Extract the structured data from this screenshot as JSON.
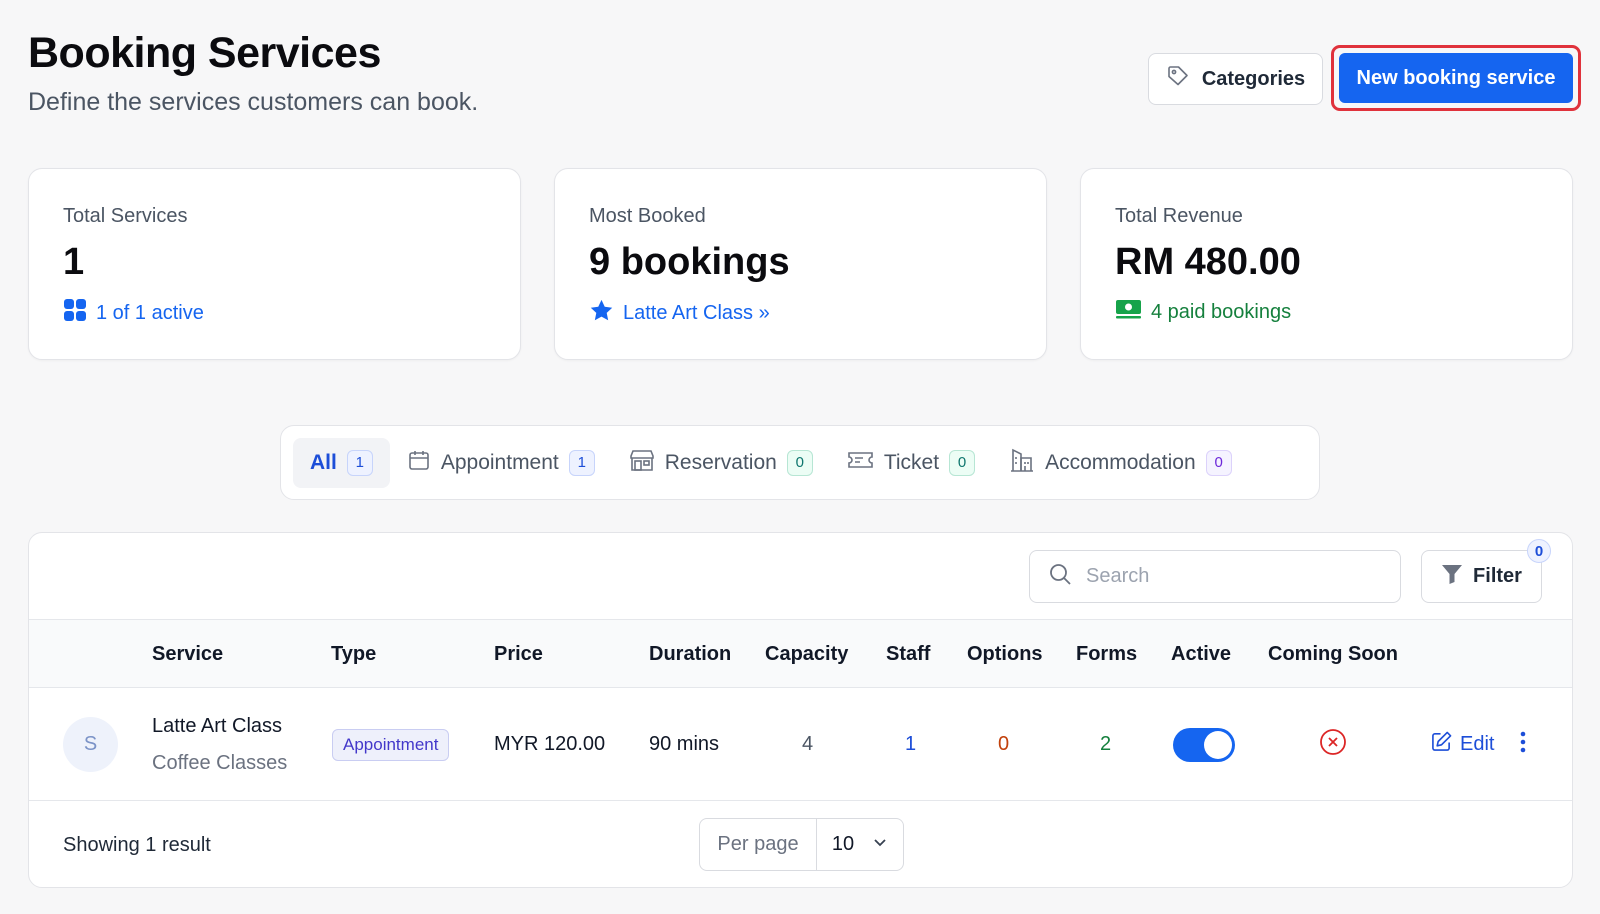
{
  "header": {
    "title": "Booking Services",
    "subtitle": "Define the services customers can book."
  },
  "actions": {
    "categories_label": "Categories",
    "new_label": "New booking service"
  },
  "stats": {
    "total_services": {
      "label": "Total Services",
      "value": "1",
      "foot": "1 of 1 active"
    },
    "most_booked": {
      "label": "Most Booked",
      "value": "9 bookings",
      "foot": "Latte Art Class »"
    },
    "total_revenue": {
      "label": "Total Revenue",
      "value": "RM 480.00",
      "foot": "4 paid bookings"
    }
  },
  "tabs": [
    {
      "label": "All",
      "count": "1"
    },
    {
      "label": "Appointment",
      "count": "1"
    },
    {
      "label": "Reservation",
      "count": "0"
    },
    {
      "label": "Ticket",
      "count": "0"
    },
    {
      "label": "Accommodation",
      "count": "0"
    }
  ],
  "toolbar": {
    "search_placeholder": "Search",
    "filter_label": "Filter",
    "filter_count": "0"
  },
  "table": {
    "columns": [
      "Service",
      "Type",
      "Price",
      "Duration",
      "Capacity",
      "Staff",
      "Options",
      "Forms",
      "Active",
      "Coming Soon"
    ],
    "rows": [
      {
        "avatar": "S",
        "name": "Latte Art Class",
        "category": "Coffee Classes",
        "type": "Appointment",
        "price": "MYR 120.00",
        "duration": "90 mins",
        "capacity": "4",
        "staff": "1",
        "options": "0",
        "forms": "2",
        "active": true,
        "coming_soon": false,
        "edit_label": "Edit"
      }
    ]
  },
  "footer": {
    "showing": "Showing 1 result",
    "per_page_label": "Per page",
    "per_page_value": "10"
  },
  "colors": {
    "primary": "#1565f0",
    "highlight_border": "#e0323c",
    "staff": "#1d4ed8",
    "options": "#c2410c",
    "forms": "#15803d",
    "coming_soon_off": "#dc2626"
  }
}
